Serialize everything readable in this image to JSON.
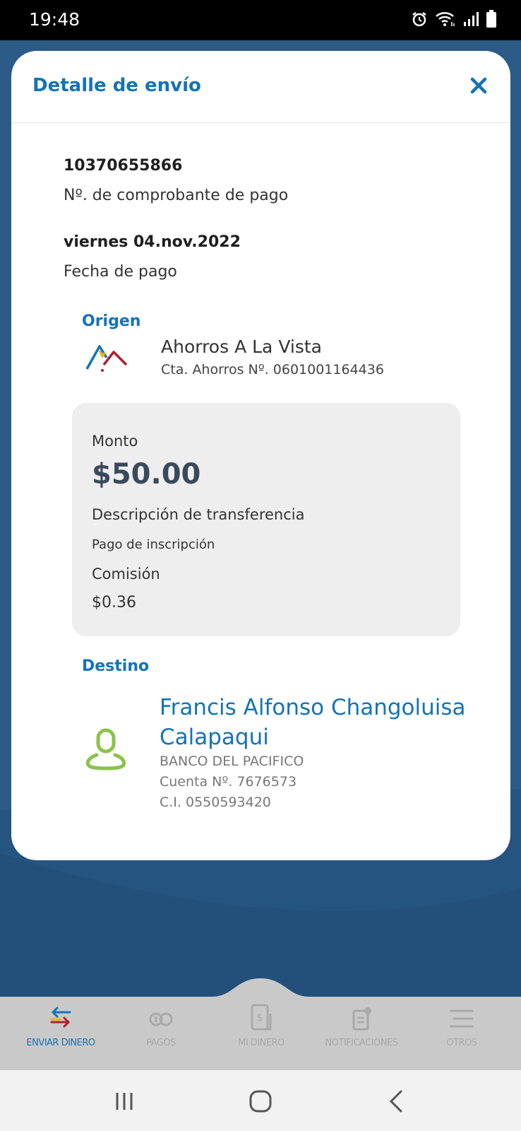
{
  "status_bar": {
    "time": "19:48",
    "icons": [
      "alarm-icon",
      "wifi-icon",
      "signal-icon",
      "battery-icon"
    ]
  },
  "modal": {
    "title": "Detalle de envío",
    "close_icon": "close-icon",
    "voucher_number": "10370655866",
    "voucher_label": "Nº. de comprobante de pago",
    "pay_date": "viernes 04.nov.2022",
    "pay_date_label": "Fecha de pago",
    "origin": {
      "title": "Origen",
      "name": "Ahorros A La Vista",
      "account": "Cta. Ahorros Nº. 0601001164436"
    },
    "amount": {
      "label": "Monto",
      "value": "$50.00",
      "desc_label": "Descripción de transferencia",
      "desc_value": "Pago de inscripción",
      "fee_label": "Comisión",
      "fee_value": "$0.36"
    },
    "destination": {
      "title": "Destino",
      "name": "Francis Alfonso Changoluisa Calapaqui",
      "bank": "BANCO DEL PACIFICO",
      "account": "Cuenta Nº. 7676573",
      "ci": "C.I. 0550593420"
    }
  },
  "bottom_nav": {
    "items": [
      {
        "label": "ENVIAR DINERO",
        "icon": "transfer-arrows-icon",
        "active": true
      },
      {
        "label": "PAGOS",
        "icon": "payments-icon",
        "active": false
      },
      {
        "label": "MI DINERO",
        "icon": "phone-money-icon",
        "active": false
      },
      {
        "label": "NOTIFICACIONES",
        "icon": "notifications-icon",
        "active": false
      },
      {
        "label": "OTROS",
        "icon": "menu-icon",
        "active": false
      }
    ]
  },
  "colors": {
    "accent": "#1473b5",
    "background": "#2b5b86",
    "avatar": "#8bc34a",
    "nav_bg": "#c9c9c9"
  }
}
